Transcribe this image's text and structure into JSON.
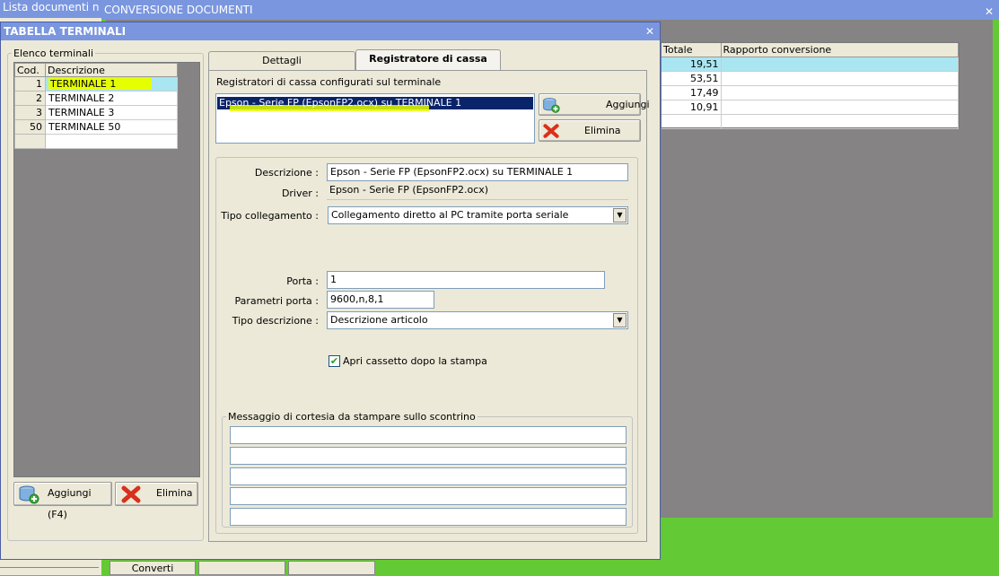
{
  "background": {
    "window_list_title": "Lista documenti n",
    "window_convert_title": "CONVERSIONE DOCUMENTI",
    "close_glyph": "✕",
    "grid": {
      "headers": [
        "Totale",
        "Rapporto conversione"
      ],
      "rows": [
        {
          "totale": "19,51",
          "rapporto": ""
        },
        {
          "totale": "53,51",
          "rapporto": ""
        },
        {
          "totale": "17,49",
          "rapporto": ""
        },
        {
          "totale": "10,91",
          "rapporto": ""
        },
        {
          "totale": "",
          "rapporto": ""
        }
      ]
    },
    "converti_label": "Converti"
  },
  "dialog": {
    "title": "TABELLA TERMINALI",
    "close_glyph": "✕",
    "terminals_group": "Elenco terminali",
    "terminals_headers": {
      "cod": "Cod.",
      "desc": "Descrizione"
    },
    "terminals": [
      {
        "cod": "1",
        "desc": "TERMINALE 1"
      },
      {
        "cod": "2",
        "desc": "TERMINALE 2"
      },
      {
        "cod": "3",
        "desc": "TERMINALE 3"
      },
      {
        "cod": "50",
        "desc": "TERMINALE 50"
      },
      {
        "cod": "",
        "desc": ""
      }
    ],
    "add_terminal_label": "Aggiungi (F4)",
    "delete_terminal_label": "Elimina",
    "tabs": [
      "Dettagli",
      "Registratore di cassa"
    ],
    "registers_caption": "Registratori di cassa configurati sul terminale",
    "registers": [
      "Epson - Serie FP (EpsonFP2.ocx) su TERMINALE 1"
    ],
    "add_register_label": "Aggiungi",
    "delete_register_label": "Elimina",
    "form": {
      "descrizione_label": "Descrizione :",
      "descrizione_value": "Epson - Serie FP (EpsonFP2.ocx) su TERMINALE 1",
      "driver_label": "Driver :",
      "driver_value": "Epson - Serie FP (EpsonFP2.ocx)",
      "tipo_collegamento_label": "Tipo collegamento :",
      "tipo_collegamento_value": "Collegamento diretto al PC tramite porta seriale",
      "porta_label": "Porta :",
      "porta_value": "1",
      "parametri_label": "Parametri porta :",
      "parametri_value": "9600,n,8,1",
      "tipo_descrizione_label": "Tipo descrizione :",
      "tipo_descrizione_value": "Descrizione articolo",
      "apri_cassetto_label": "Apri cassetto dopo la stampa",
      "apri_cassetto_checked": true,
      "messaggio_group": "Messaggio di cortesia da stampare sullo scontrino",
      "messaggio_lines": [
        "",
        "",
        "",
        "",
        ""
      ]
    }
  },
  "colors": {
    "desktop_green": "#63c934",
    "title_blue": "#7a96df",
    "selection_cyan": "#a9e6f2",
    "highlighter": "#e6ff00",
    "list_selection": "#0a246a"
  }
}
